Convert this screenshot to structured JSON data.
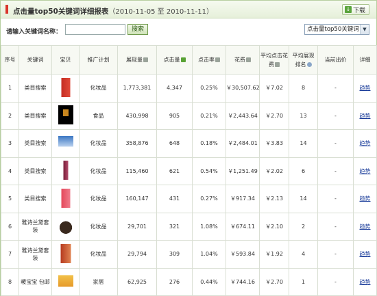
{
  "header": {
    "title": "点击量top50关键词详细报表",
    "date_range": "（2010-11-05 至 2010-11-11）",
    "download_label": "下载"
  },
  "search": {
    "label": "请输入关键词名称：",
    "input_value": "",
    "button_label": "搜索",
    "select_value": "点击量top50关键词"
  },
  "table": {
    "columns": [
      "序号",
      "关键词",
      "宝贝",
      "推广计划",
      "展现量",
      "点击量",
      "点击率",
      "花费",
      "平均点击花费",
      "平均展现排名",
      "当前出价",
      "详细"
    ],
    "trend_label": "趋势",
    "rows": [
      {
        "no": "1",
        "keyword": "类目搜索",
        "plan": "化妆品",
        "impressions": "1,773,381",
        "clicks": "4,347",
        "ctr": "0.25%",
        "cost": "￥30,507.62",
        "cpc": "￥7.02",
        "rank": "8",
        "bid": "-"
      },
      {
        "no": "2",
        "keyword": "类目搜索",
        "plan": "食品",
        "impressions": "430,998",
        "clicks": "905",
        "ctr": "0.21%",
        "cost": "￥2,443.64",
        "cpc": "￥2.70",
        "rank": "13",
        "bid": "-"
      },
      {
        "no": "3",
        "keyword": "类目搜索",
        "plan": "化妆品",
        "impressions": "358,876",
        "clicks": "648",
        "ctr": "0.18%",
        "cost": "￥2,484.01",
        "cpc": "￥3.83",
        "rank": "14",
        "bid": "-"
      },
      {
        "no": "4",
        "keyword": "类目搜索",
        "plan": "化妆品",
        "impressions": "115,460",
        "clicks": "621",
        "ctr": "0.54%",
        "cost": "￥1,251.49",
        "cpc": "￥2.02",
        "rank": "6",
        "bid": "-"
      },
      {
        "no": "5",
        "keyword": "类目搜索",
        "plan": "化妆品",
        "impressions": "160,147",
        "clicks": "431",
        "ctr": "0.27%",
        "cost": "￥917.34",
        "cpc": "￥2.13",
        "rank": "14",
        "bid": "-"
      },
      {
        "no": "6",
        "keyword": "雅诗兰黛套装",
        "plan": "化妆品",
        "impressions": "29,701",
        "clicks": "321",
        "ctr": "1.08%",
        "cost": "￥674.11",
        "cpc": "￥2.10",
        "rank": "2",
        "bid": "-"
      },
      {
        "no": "7",
        "keyword": "雅诗兰黛套装",
        "plan": "化妆品",
        "impressions": "29,794",
        "clicks": "309",
        "ctr": "1.04%",
        "cost": "￥593.84",
        "cpc": "￥1.92",
        "rank": "4",
        "bid": "-"
      },
      {
        "no": "8",
        "keyword": "暖宝宝 包邮",
        "plan": "家居",
        "impressions": "62,925",
        "clicks": "276",
        "ctr": "0.44%",
        "cost": "￥744.16",
        "cpc": "￥2.70",
        "rank": "1",
        "bid": "-"
      }
    ]
  }
}
